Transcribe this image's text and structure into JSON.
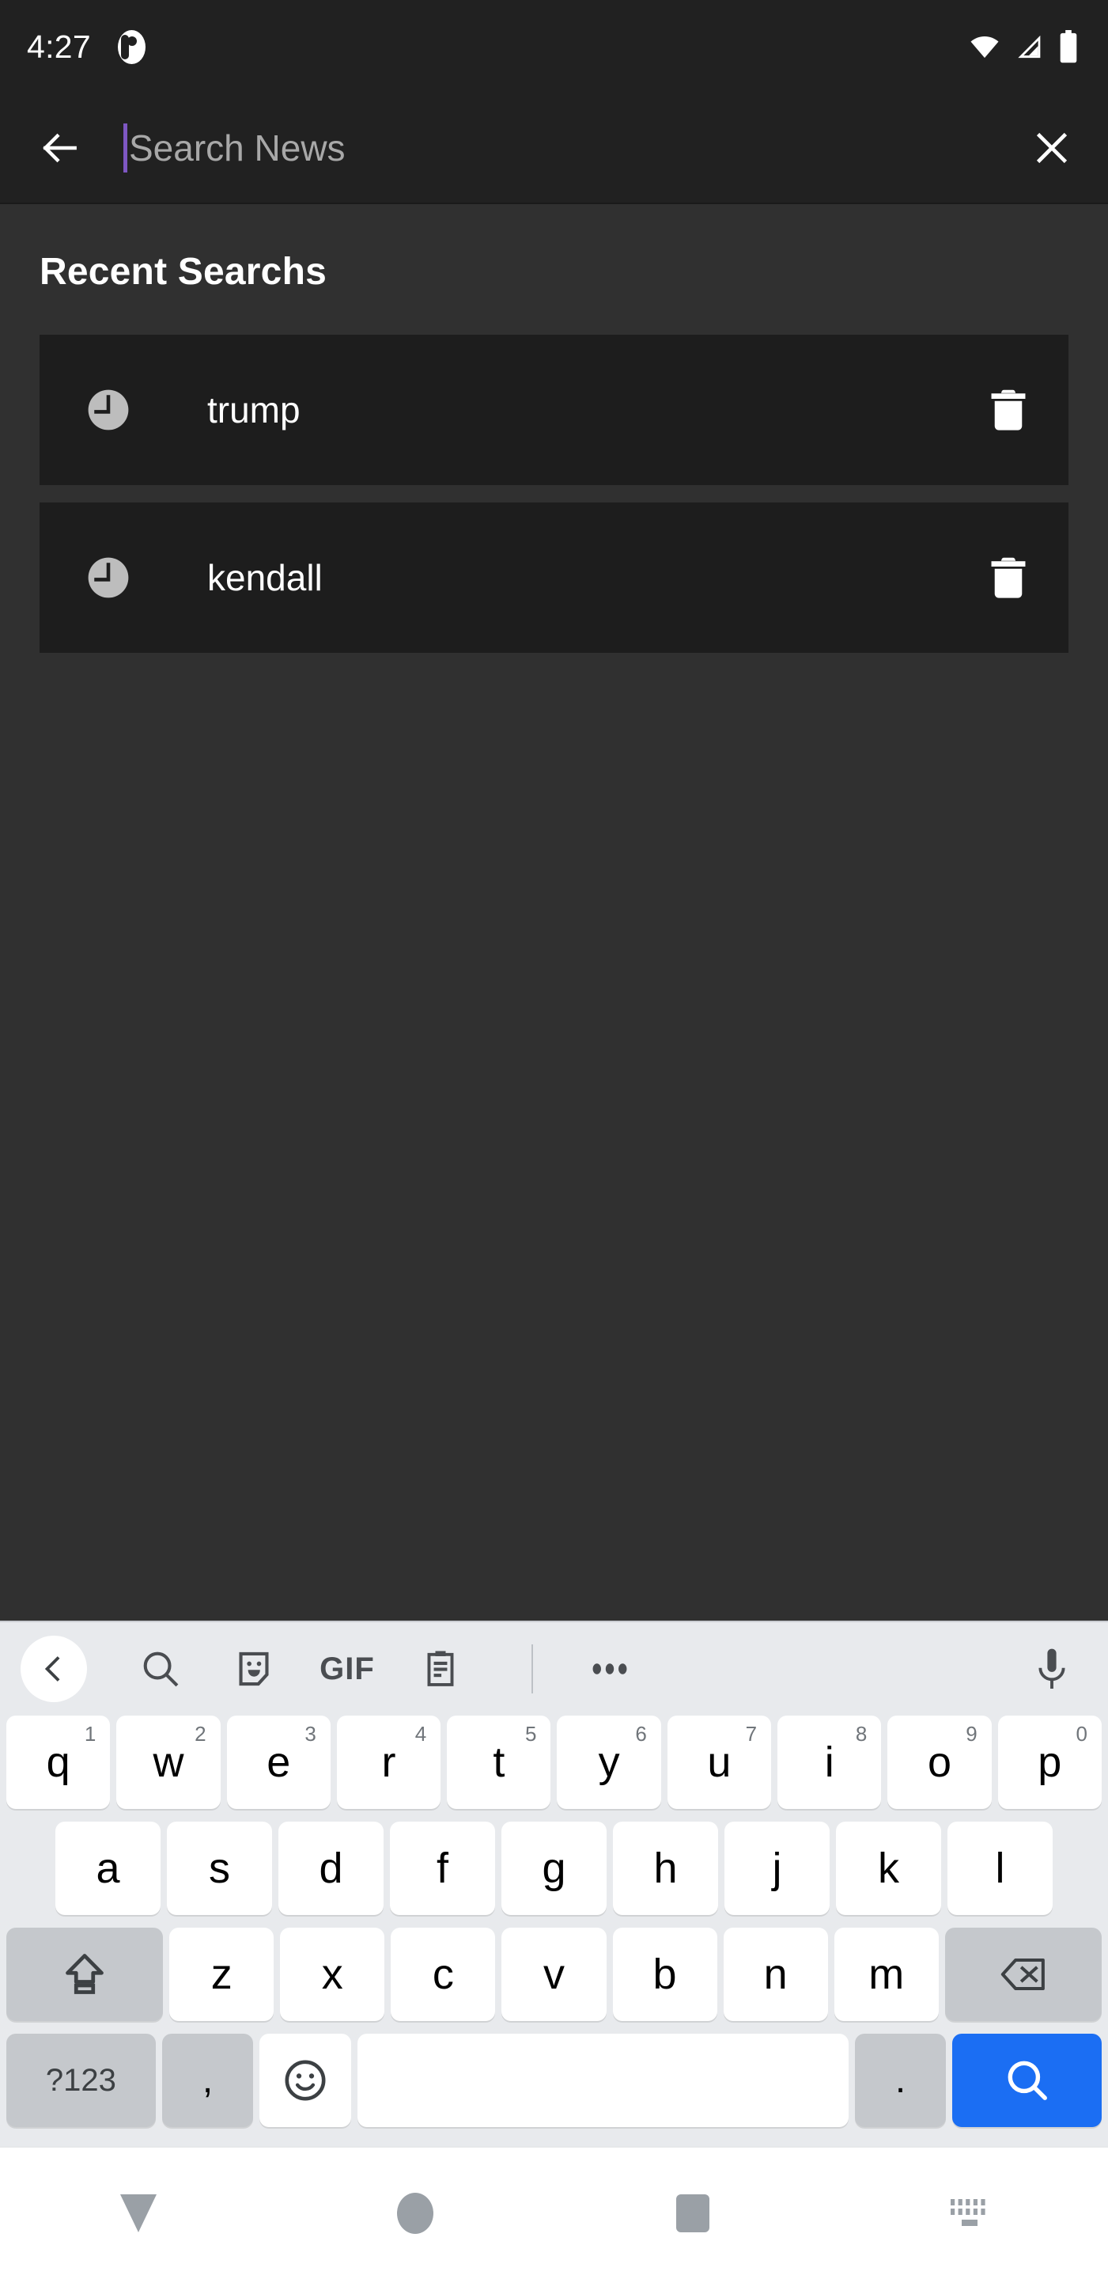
{
  "status_bar": {
    "time": "4:27",
    "app_icon": "app-notification-icon",
    "icons": [
      "wifi-icon",
      "cellular-signal-icon",
      "battery-icon"
    ]
  },
  "app_bar": {
    "back_icon": "back-arrow-icon",
    "search_placeholder": "Search News",
    "search_value": "",
    "close_icon": "close-icon",
    "caret_color": "#7e57c2"
  },
  "content": {
    "section_title": "Recent Searchs",
    "recent_searches": [
      {
        "label": "trump",
        "history_icon": "clock-icon",
        "delete_icon": "trash-icon"
      },
      {
        "label": "kendall",
        "history_icon": "clock-icon",
        "delete_icon": "trash-icon"
      }
    ]
  },
  "keyboard": {
    "toolbar": [
      {
        "name": "back-chevron-icon",
        "label": ""
      },
      {
        "name": "search-icon",
        "label": ""
      },
      {
        "name": "sticker-icon",
        "label": ""
      },
      {
        "name": "gif-icon",
        "label": "GIF"
      },
      {
        "name": "clipboard-icon",
        "label": ""
      },
      {
        "name": "more-options-icon",
        "label": ""
      },
      {
        "name": "microphone-icon",
        "label": ""
      }
    ],
    "row1": [
      {
        "letter": "q",
        "num": "1"
      },
      {
        "letter": "w",
        "num": "2"
      },
      {
        "letter": "e",
        "num": "3"
      },
      {
        "letter": "r",
        "num": "4"
      },
      {
        "letter": "t",
        "num": "5"
      },
      {
        "letter": "y",
        "num": "6"
      },
      {
        "letter": "u",
        "num": "7"
      },
      {
        "letter": "i",
        "num": "8"
      },
      {
        "letter": "o",
        "num": "9"
      },
      {
        "letter": "p",
        "num": "0"
      }
    ],
    "row2": [
      {
        "letter": "a"
      },
      {
        "letter": "s"
      },
      {
        "letter": "d"
      },
      {
        "letter": "f"
      },
      {
        "letter": "g"
      },
      {
        "letter": "h"
      },
      {
        "letter": "j"
      },
      {
        "letter": "k"
      },
      {
        "letter": "l"
      }
    ],
    "row3": [
      {
        "letter": "z"
      },
      {
        "letter": "x"
      },
      {
        "letter": "c"
      },
      {
        "letter": "v"
      },
      {
        "letter": "b"
      },
      {
        "letter": "n"
      },
      {
        "letter": "m"
      }
    ],
    "shift_icon": "shift-key-icon",
    "backspace_icon": "backspace-key-icon",
    "row4": {
      "symbols_label": "?123",
      "comma_label": ",",
      "emoji_icon": "emoji-key-icon",
      "space_label": "",
      "period_label": ".",
      "enter_icon": "search-enter-key-icon"
    },
    "accent_color": "#1b6ef3"
  },
  "nav_bar": {
    "back": "nav-back-icon",
    "home": "nav-home-icon",
    "recents": "nav-recents-icon",
    "keyboard_switcher": "nav-keyboard-switcher-icon"
  }
}
